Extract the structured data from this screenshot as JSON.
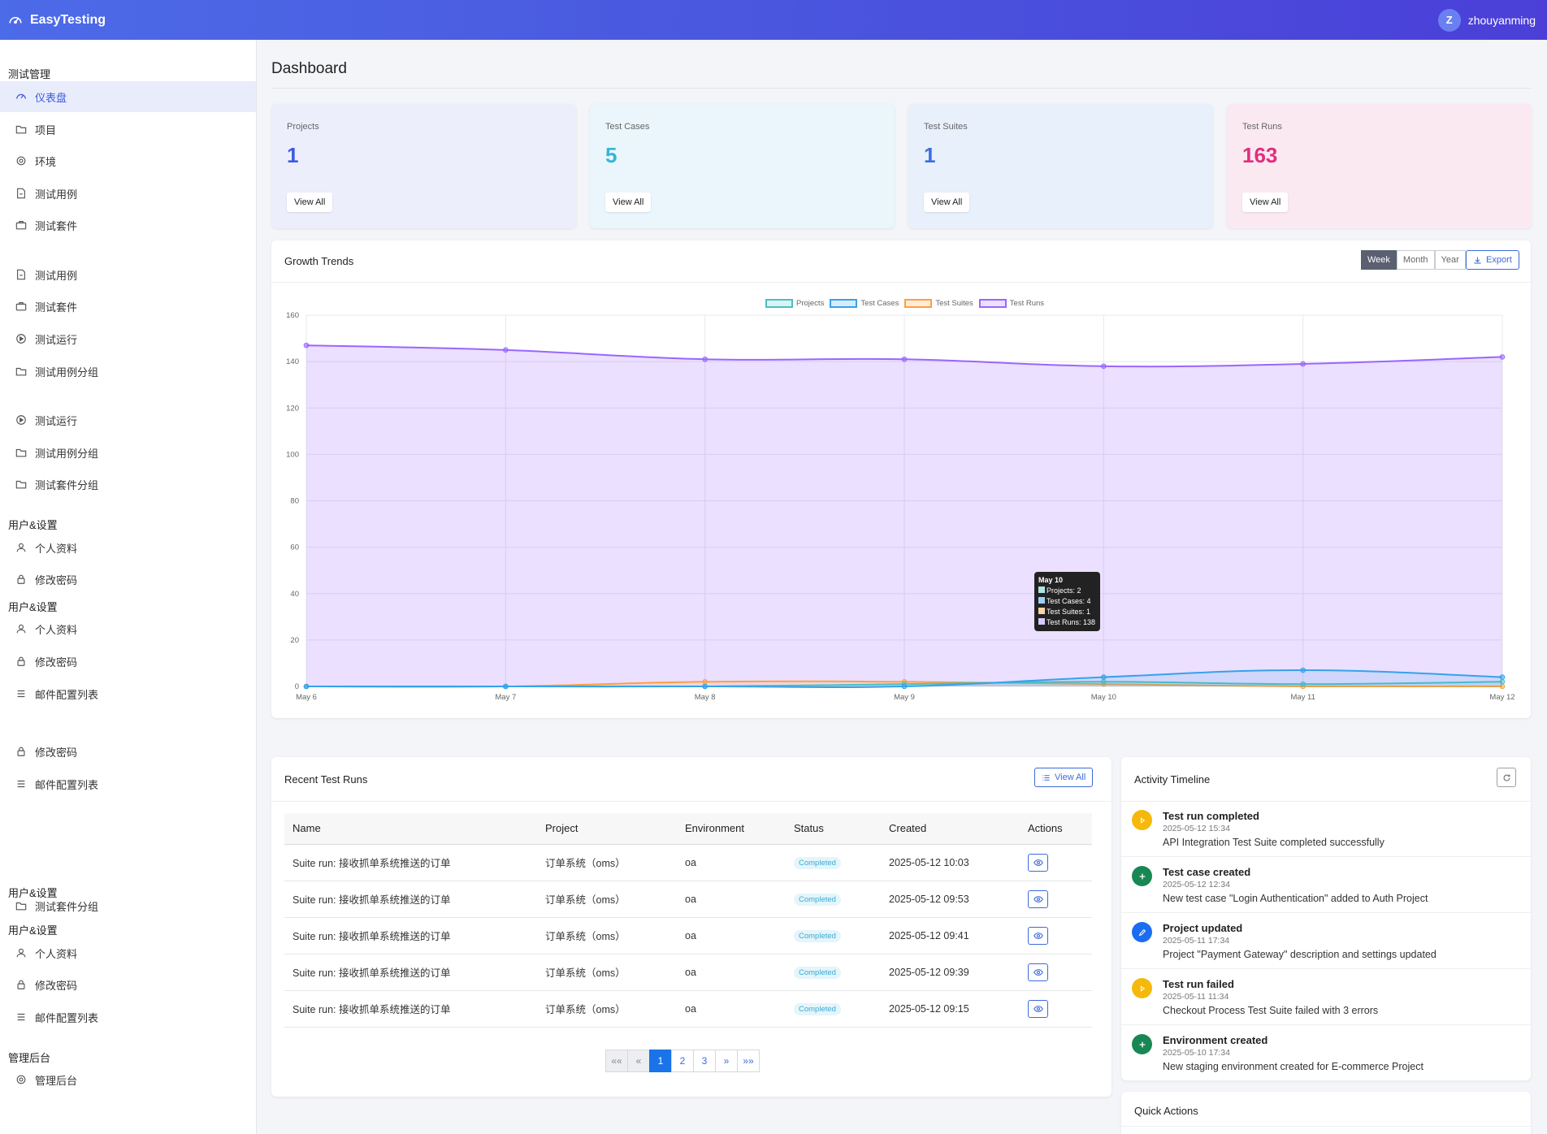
{
  "app": {
    "brand": "EasyTesting",
    "user_initial": "Z",
    "user_name": "zhouyanming"
  },
  "sidebar": {
    "heads": [
      "测试管理",
      "用户&设置",
      "用户&设置",
      "用户&设置",
      "用户&设置",
      "管理后台"
    ],
    "items": {
      "dashboard": "仪表盘",
      "projects": "项目",
      "env": "环境",
      "cases": "测试用例",
      "suites": "测试套件",
      "runs": "测试运行",
      "case_groups": "测试用例分组",
      "suite_groups": "测试套件分组",
      "profile": "个人资料",
      "password": "修改密码",
      "mail": "邮件配置列表",
      "admin": "管理后台"
    }
  },
  "page": {
    "title": "Dashboard"
  },
  "stats": [
    {
      "label": "Projects",
      "value": "1",
      "button": "View All",
      "color": "#3c5be0",
      "bg": "#eceefc"
    },
    {
      "label": "Test Cases",
      "value": "5",
      "button": "View All",
      "color": "#35b5d6",
      "bg": "#eaf6fb"
    },
    {
      "label": "Test Suites",
      "value": "1",
      "button": "View All",
      "color": "#3b6ee0",
      "bg": "#e8f0fb"
    },
    {
      "label": "Test Runs",
      "value": "163",
      "button": "View All",
      "color": "#e02f7e",
      "bg": "#fbe9f1"
    }
  ],
  "growth": {
    "title": "Growth Trends",
    "ranges": [
      "Week",
      "Month",
      "Year"
    ],
    "active_range": "Week",
    "export_label": "Export",
    "tooltip": {
      "title": "May 10",
      "lines": [
        "Projects: 2",
        "Test Cases: 4",
        "Test Suites: 1",
        "Test Runs: 138"
      ]
    }
  },
  "chart_data": {
    "type": "area",
    "categories": [
      "May 6",
      "May 7",
      "May 8",
      "May 9",
      "May 10",
      "May 11",
      "May 12"
    ],
    "series": [
      {
        "name": "Projects",
        "color": "#4bc0c0",
        "values": [
          0,
          0,
          0,
          1,
          2,
          1,
          2
        ]
      },
      {
        "name": "Test Cases",
        "color": "#36a2eb",
        "values": [
          0,
          0,
          0,
          0,
          4,
          7,
          4
        ]
      },
      {
        "name": "Test Suites",
        "color": "#ff9f40",
        "values": [
          0,
          0,
          2,
          2,
          1,
          0,
          0
        ]
      },
      {
        "name": "Test Runs",
        "color": "#9966ff",
        "values": [
          147,
          145,
          141,
          141,
          138,
          139,
          142
        ]
      }
    ],
    "ylim": [
      0,
      160
    ],
    "yticks": [
      "0",
      "20",
      "40",
      "60",
      "80",
      "100",
      "120",
      "140",
      "160"
    ],
    "legend": "top",
    "grid": true
  },
  "recent": {
    "title": "Recent Test Runs",
    "view_all": "View All",
    "columns": [
      "Name",
      "Project",
      "Environment",
      "Status",
      "Created",
      "Actions"
    ],
    "rows": [
      {
        "name": "Suite run: 接收抓单系统推送的订单",
        "project": "订单系统（oms）",
        "env": "oa",
        "status": "Completed",
        "created": "2025-05-12 10:03"
      },
      {
        "name": "Suite run: 接收抓单系统推送的订单",
        "project": "订单系统（oms）",
        "env": "oa",
        "status": "Completed",
        "created": "2025-05-12 09:53"
      },
      {
        "name": "Suite run: 接收抓单系统推送的订单",
        "project": "订单系统（oms）",
        "env": "oa",
        "status": "Completed",
        "created": "2025-05-12 09:41"
      },
      {
        "name": "Suite run: 接收抓单系统推送的订单",
        "project": "订单系统（oms）",
        "env": "oa",
        "status": "Completed",
        "created": "2025-05-12 09:39"
      },
      {
        "name": "Suite run: 接收抓单系统推送的订单",
        "project": "订单系统（oms）",
        "env": "oa",
        "status": "Completed",
        "created": "2025-05-12 09:15"
      }
    ],
    "pager": [
      "««",
      "«",
      "1",
      "2",
      "3",
      "»",
      "»»"
    ]
  },
  "timeline": {
    "title": "Activity Timeline",
    "items": [
      {
        "title": "Test run completed",
        "date": "2025-05-12 15:34",
        "text": "API Integration Test Suite completed successfully",
        "color": "#f5b80b",
        "icon": "play-icon"
      },
      {
        "title": "Test case created",
        "date": "2025-05-12 12:34",
        "text": "New test case \"Login Authentication\" added to Auth Project",
        "color": "#198754",
        "icon": "plus-icon"
      },
      {
        "title": "Project updated",
        "date": "2025-05-11 17:34",
        "text": "Project \"Payment Gateway\" description and settings updated",
        "color": "#1a6df0",
        "icon": "pencil-icon"
      },
      {
        "title": "Test run failed",
        "date": "2025-05-11 11:34",
        "text": "Checkout Process Test Suite failed with 3 errors",
        "color": "#f5b80b",
        "icon": "play-icon"
      },
      {
        "title": "Environment created",
        "date": "2025-05-10 17:34",
        "text": "New staging environment created for E-commerce Project",
        "color": "#198754",
        "icon": "plus-icon"
      }
    ]
  },
  "quick": {
    "title": "Quick Actions"
  }
}
